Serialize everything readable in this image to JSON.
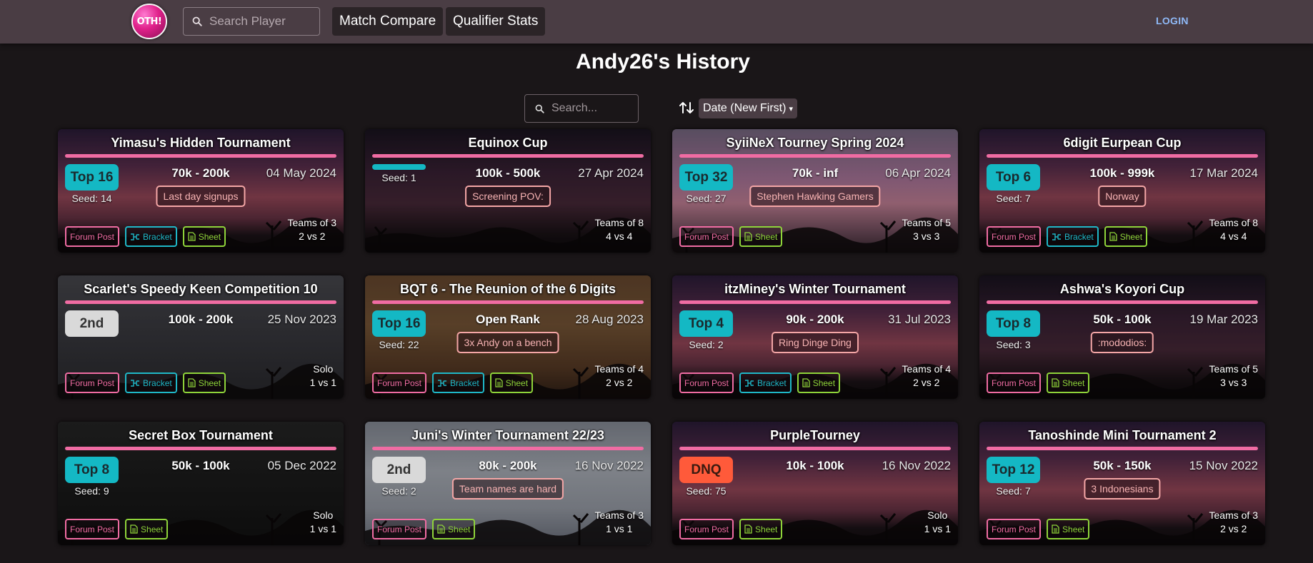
{
  "nav": {
    "logo_text": "OTH!",
    "search_placeholder": "Search Player",
    "match_compare": "Match Compare",
    "qualifier_stats": "Qualifier Stats",
    "login": "LOGIN"
  },
  "page": {
    "title": "Andy26's History",
    "search_placeholder": "Search...",
    "sort_value": "Date (New First)"
  },
  "labels": {
    "forum": "Forum Post",
    "bracket": "Bracket",
    "sheet": "Sheet"
  },
  "colors": {
    "accent_pink": "#f06ca3",
    "top_badge": "#14b8c4",
    "dnq_badge": "#ff5a3a",
    "sheet_green": "#8fd43a",
    "navbar": "#4a3d44"
  },
  "cards": [
    {
      "title": "Yimasu's Hidden Tournament",
      "badge": "Top 16",
      "badge_type": "top",
      "seed": "Seed: 14",
      "rank": "70k - 200k",
      "date": "04 May 2024",
      "note": "Last day signups",
      "teams_line1": "Teams of 3",
      "teams_line2": "2 vs 2",
      "links": [
        "forum",
        "bracket",
        "sheet"
      ],
      "bg": "dusk"
    },
    {
      "title": "Equinox Cup",
      "badge": "",
      "badge_type": "bar",
      "seed": "Seed: 1",
      "rank": "100k - 500k",
      "date": "27 Apr 2024",
      "note": "Screening POV:",
      "teams_line1": "Teams of 8",
      "teams_line2": "4 vs 4",
      "links": [],
      "bg": "dusk-dark"
    },
    {
      "title": "SyiiNeX Tourney Spring 2024",
      "badge": "Top 32",
      "badge_type": "top",
      "seed": "Seed: 27",
      "rank": "70k - inf",
      "date": "06 Apr 2024",
      "note": "Stephen Hawking Gamers",
      "teams_line1": "Teams of 5",
      "teams_line2": "3 vs 3",
      "links": [
        "forum",
        "sheet"
      ],
      "bg": "light"
    },
    {
      "title": "6digit Eurpean Cup",
      "badge": "Top 6",
      "badge_type": "top",
      "seed": "Seed: 7",
      "rank": "100k - 999k",
      "date": "17 Mar 2024",
      "note": "Norway",
      "teams_line1": "Teams of 8",
      "teams_line2": "4 vs 4",
      "links": [
        "forum",
        "bracket",
        "sheet"
      ],
      "bg": "dusk"
    },
    {
      "title": "Scarlet's Speedy Keen Competition 10",
      "badge": "2nd",
      "badge_type": "second",
      "seed": "",
      "rank": "100k - 200k",
      "date": "25 Nov 2023",
      "note": "",
      "teams_line1": "Solo",
      "teams_line2": "1 vs 1",
      "links": [
        "forum",
        "bracket",
        "sheet"
      ],
      "bg": "grey"
    },
    {
      "title": "BQT 6 - The Reunion of the 6 Digits",
      "badge": "Top 16",
      "badge_type": "top",
      "seed": "Seed: 22",
      "rank": "Open Rank",
      "date": "28 Aug 2023",
      "note": "3x Andy on a bench",
      "teams_line1": "Teams of 4",
      "teams_line2": "2 vs 2",
      "links": [
        "forum",
        "bracket",
        "sheet"
      ],
      "bg": "orange"
    },
    {
      "title": "itzMiney's Winter Tournament",
      "badge": "Top 4",
      "badge_type": "top",
      "seed": "Seed: 2",
      "rank": "90k - 200k",
      "date": "31 Jul 2023",
      "note": "Ring Dinge Ding",
      "teams_line1": "Teams of 4",
      "teams_line2": "2 vs 2",
      "links": [
        "forum",
        "bracket",
        "sheet"
      ],
      "bg": "dusk"
    },
    {
      "title": "Ashwa's Koyori Cup",
      "badge": "Top 8",
      "badge_type": "top",
      "seed": "Seed: 3",
      "rank": "50k - 100k",
      "date": "19 Mar 2023",
      "note": ":mododios:",
      "teams_line1": "Teams of 5",
      "teams_line2": "3 vs 3",
      "links": [
        "forum",
        "sheet"
      ],
      "bg": "dusk-dark"
    },
    {
      "title": "Secret Box Tournament",
      "badge": "Top 8",
      "badge_type": "top",
      "seed": "Seed: 9",
      "rank": "50k - 100k",
      "date": "05 Dec 2022",
      "note": "",
      "teams_line1": "Solo",
      "teams_line2": "1 vs 1",
      "links": [
        "forum",
        "sheet"
      ],
      "bg": "black"
    },
    {
      "title": "Juni's Winter Tournament 22/23",
      "badge": "2nd",
      "badge_type": "second",
      "seed": "Seed: 2",
      "rank": "80k - 200k",
      "date": "16 Nov 2022",
      "note": "Team names are hard",
      "teams_line1": "Teams of 3",
      "teams_line2": "1 vs 1",
      "links": [
        "forum",
        "sheet"
      ],
      "bg": "snow"
    },
    {
      "title": "PurpleTourney",
      "badge": "DNQ",
      "badge_type": "dnq",
      "seed": "Seed: 75",
      "rank": "10k - 100k",
      "date": "16 Nov 2022",
      "note": "",
      "teams_line1": "Solo",
      "teams_line2": "1 vs 1",
      "links": [
        "forum",
        "sheet"
      ],
      "bg": "dusk"
    },
    {
      "title": "Tanoshinde Mini Tournament 2",
      "badge": "Top 12",
      "badge_type": "top",
      "seed": "Seed: 7",
      "rank": "50k - 150k",
      "date": "15 Nov 2022",
      "note": "3 Indonesians",
      "teams_line1": "Teams of 3",
      "teams_line2": "2 vs 2",
      "links": [
        "forum",
        "sheet"
      ],
      "bg": "dusk"
    }
  ]
}
